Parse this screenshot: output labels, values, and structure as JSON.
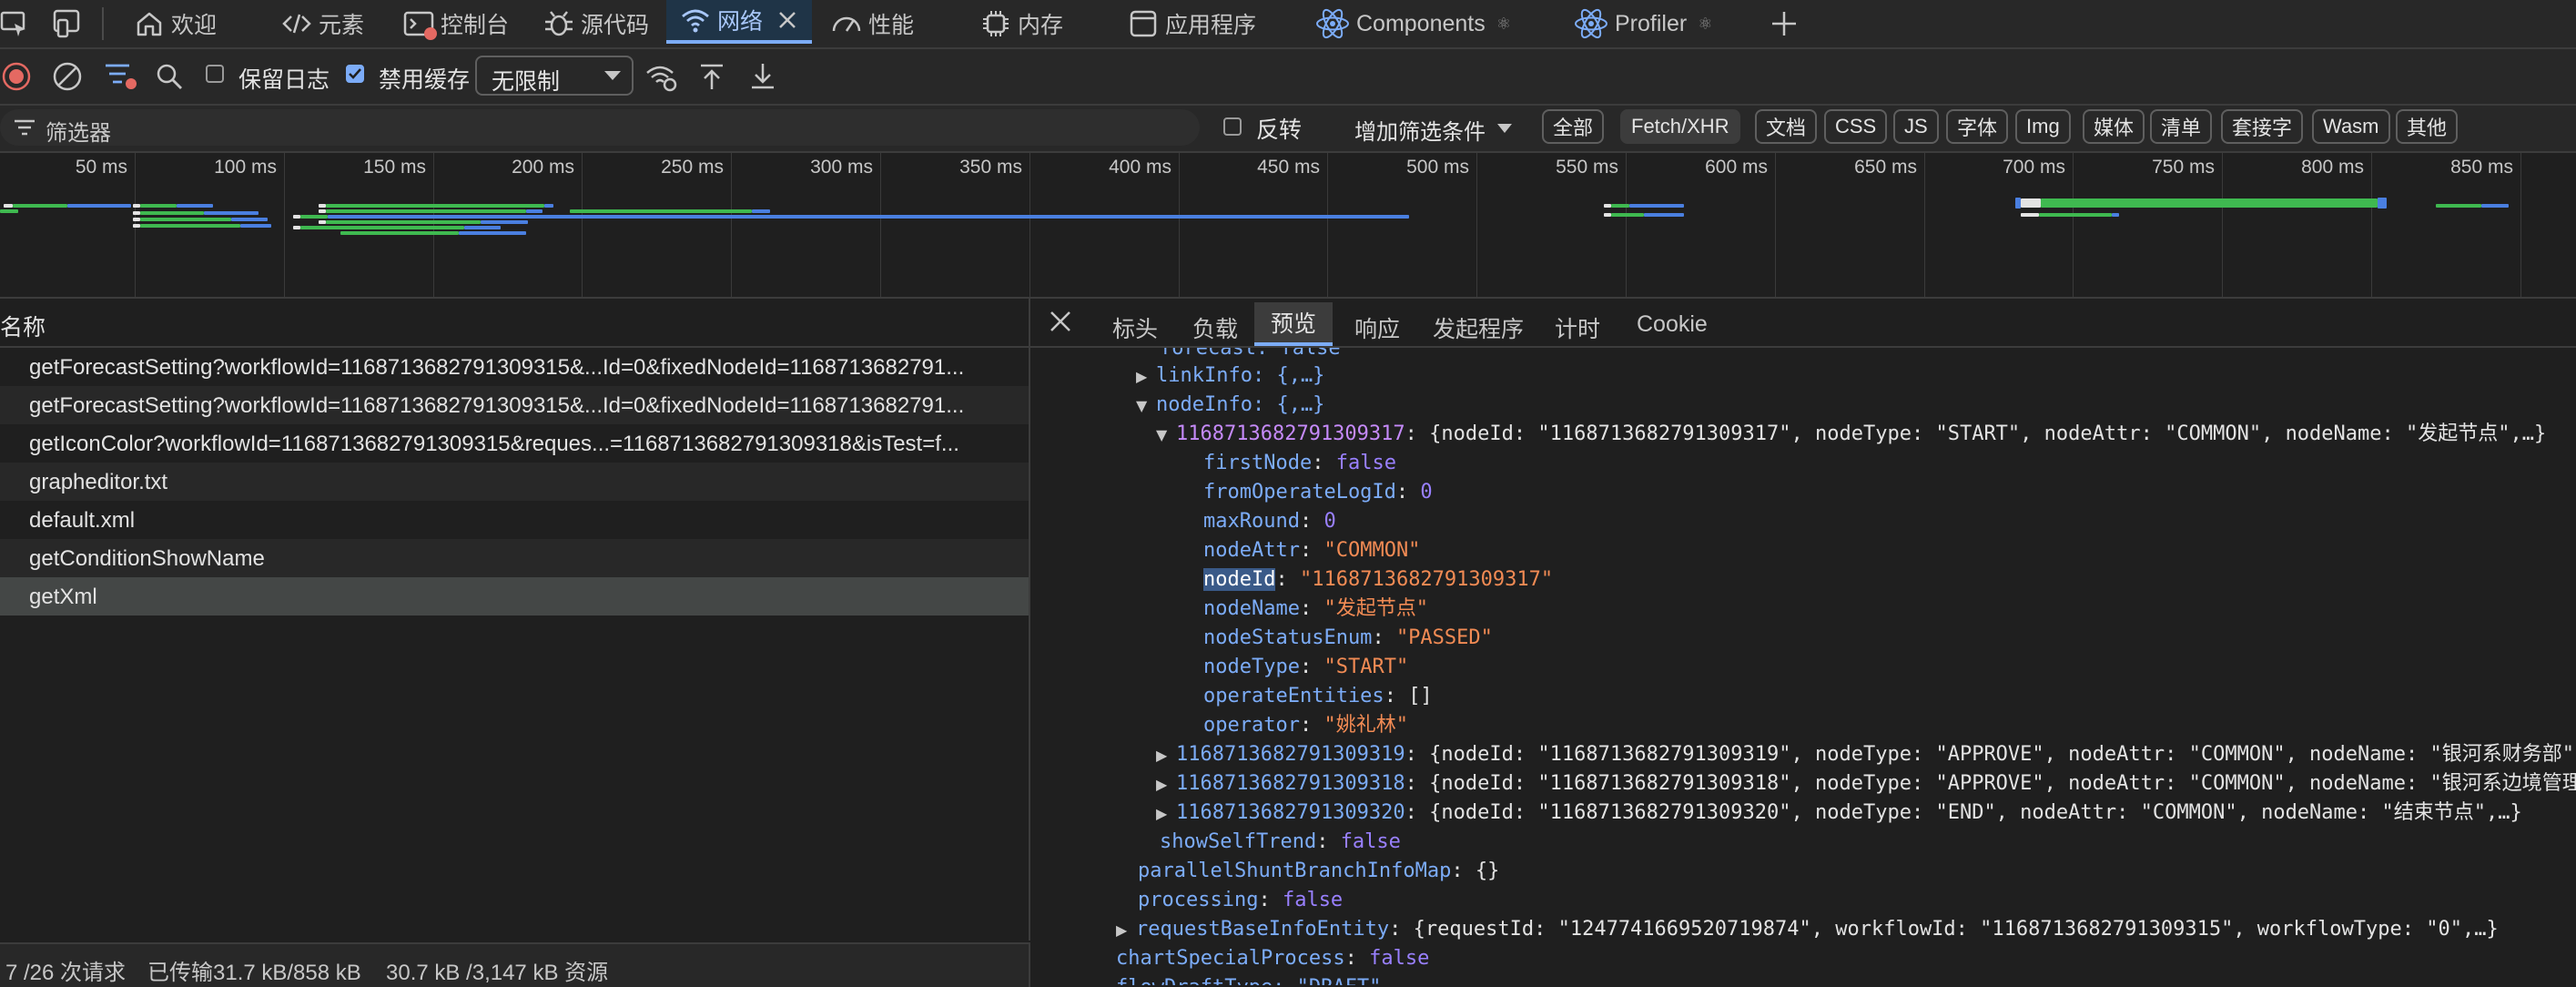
{
  "tabs": [
    {
      "label": "欢迎",
      "icon": "home-icon"
    },
    {
      "label": "元素",
      "icon": "code-icon"
    },
    {
      "label": "控制台",
      "icon": "console-icon"
    },
    {
      "label": "源代码",
      "icon": "bug-icon"
    },
    {
      "label": "网络",
      "icon": "wifi-icon",
      "active": true
    },
    {
      "label": "性能",
      "icon": "gauge-icon"
    },
    {
      "label": "内存",
      "icon": "memory-chip-icon"
    },
    {
      "label": "应用程序",
      "icon": "window-icon"
    },
    {
      "label": "Components",
      "icon": "react-icon",
      "suffix": "⚛"
    },
    {
      "label": "Profiler",
      "icon": "react-icon",
      "suffix": "⚛"
    }
  ],
  "toolbar": {
    "preserve_log_label": "保留日志",
    "preserve_log_checked": false,
    "disable_cache_label": "禁用缓存",
    "disable_cache_checked": true,
    "throttle_value": "无限制"
  },
  "filterbar": {
    "placeholder": "筛选器",
    "invert_label": "反转",
    "invert_checked": false,
    "more_filters_label": "增加筛选条件",
    "chips": [
      "全部",
      "Fetch/XHR",
      "文档",
      "CSS",
      "JS",
      "字体",
      "Img",
      "媒体",
      "清单",
      "套接字",
      "Wasm",
      "其他"
    ],
    "active_chip": "Fetch/XHR"
  },
  "timeline": {
    "ticks": [
      "50 ms",
      "100 ms",
      "150 ms",
      "200 ms",
      "250 ms",
      "300 ms",
      "350 ms",
      "400 ms",
      "450 ms",
      "500 ms",
      "550 ms",
      "600 ms",
      "650 ms",
      "700 ms",
      "750 ms",
      "800 ms",
      "850 ms"
    ]
  },
  "requests": {
    "column_header": "名称",
    "rows": [
      "getForecastSetting?workflowId=1168713682791309315&...Id=0&fixedNodeId=1168713682791...",
      "getForecastSetting?workflowId=1168713682791309315&...Id=0&fixedNodeId=1168713682791...",
      "getIconColor?workflowId=1168713682791309315&reques...=1168713682791309318&isTest=f...",
      "grapheditor.txt",
      "default.xml",
      "getConditionShowName",
      "getXml"
    ],
    "selected_index": 6
  },
  "status": {
    "requests": "7 /26 次请求",
    "transferred": "已传输31.7 kB/858 kB",
    "resources": "30.7 kB /3,147 kB 资源"
  },
  "detail_tabs": [
    "标头",
    "负载",
    "预览",
    "响应",
    "发起程序",
    "计时",
    "Cookie"
  ],
  "detail_active_tab": "预览",
  "preview": {
    "line0": "forecast: false",
    "linkInfo": "linkInfo: {,…}",
    "nodeInfo": "nodeInfo: {,…}",
    "node1_key": "1168713682791309317",
    "node1_summary": ": {nodeId: \"1168713682791309317\", nodeType: \"START\", nodeAttr: \"COMMON\", nodeName: \"发起节点\",…}",
    "firstNode": "false",
    "fromOperateLogId": "0",
    "maxRound": "0",
    "nodeAttr": "\"COMMON\"",
    "nodeId_key": "nodeId",
    "nodeId": "\"1168713682791309317\"",
    "nodeName": "\"发起节点\"",
    "nodeStatusEnum": "\"PASSED\"",
    "nodeType": "\"START\"",
    "operateEntities": "[]",
    "operator": "\"姚礼林\"",
    "node2_key": "1168713682791309319",
    "node2_summary": ": {nodeId: \"1168713682791309319\", nodeType: \"APPROVE\", nodeAttr: \"COMMON\", nodeName: \"银河系财务部\"",
    "node3_key": "1168713682791309318",
    "node3_summary": ": {nodeId: \"1168713682791309318\", nodeType: \"APPROVE\", nodeAttr: \"COMMON\", nodeName: \"银河系边境管理",
    "node4_key": "1168713682791309320",
    "node4_summary": ": {nodeId: \"1168713682791309320\", nodeType: \"END\", nodeAttr: \"COMMON\", nodeName: \"结束节点\",…}",
    "showSelfTrend": "false",
    "parallelShuntBranchInfoMap": "{}",
    "processing": "false",
    "requestBaseInfoEntity": ": {requestId: \"1247741669520719874\", workflowId: \"1168713682791309315\", workflowType: \"0\",…}",
    "chartSpecialProcess": "false",
    "last_line": "flowDraftType: \"DRAFT\""
  },
  "colors": {
    "accent": "#7cacf8",
    "string": "#f28b54",
    "number": "#9980ff",
    "bar_blue": "#4a7fe0",
    "bar_green": "#3fb950"
  }
}
